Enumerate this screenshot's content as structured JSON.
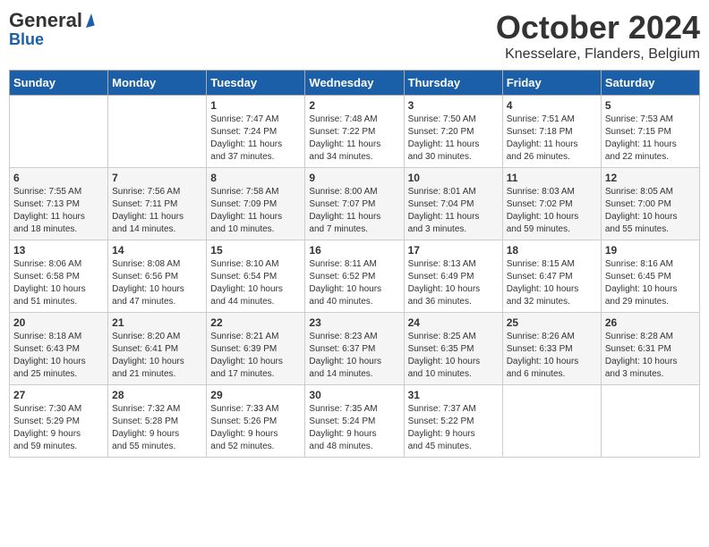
{
  "header": {
    "logo_general": "General",
    "logo_blue": "Blue",
    "month_title": "October 2024",
    "location": "Knesselare, Flanders, Belgium"
  },
  "days_of_week": [
    "Sunday",
    "Monday",
    "Tuesday",
    "Wednesday",
    "Thursday",
    "Friday",
    "Saturday"
  ],
  "weeks": [
    [
      {
        "day": "",
        "content": ""
      },
      {
        "day": "",
        "content": ""
      },
      {
        "day": "1",
        "content": "Sunrise: 7:47 AM\nSunset: 7:24 PM\nDaylight: 11 hours\nand 37 minutes."
      },
      {
        "day": "2",
        "content": "Sunrise: 7:48 AM\nSunset: 7:22 PM\nDaylight: 11 hours\nand 34 minutes."
      },
      {
        "day": "3",
        "content": "Sunrise: 7:50 AM\nSunset: 7:20 PM\nDaylight: 11 hours\nand 30 minutes."
      },
      {
        "day": "4",
        "content": "Sunrise: 7:51 AM\nSunset: 7:18 PM\nDaylight: 11 hours\nand 26 minutes."
      },
      {
        "day": "5",
        "content": "Sunrise: 7:53 AM\nSunset: 7:15 PM\nDaylight: 11 hours\nand 22 minutes."
      }
    ],
    [
      {
        "day": "6",
        "content": "Sunrise: 7:55 AM\nSunset: 7:13 PM\nDaylight: 11 hours\nand 18 minutes."
      },
      {
        "day": "7",
        "content": "Sunrise: 7:56 AM\nSunset: 7:11 PM\nDaylight: 11 hours\nand 14 minutes."
      },
      {
        "day": "8",
        "content": "Sunrise: 7:58 AM\nSunset: 7:09 PM\nDaylight: 11 hours\nand 10 minutes."
      },
      {
        "day": "9",
        "content": "Sunrise: 8:00 AM\nSunset: 7:07 PM\nDaylight: 11 hours\nand 7 minutes."
      },
      {
        "day": "10",
        "content": "Sunrise: 8:01 AM\nSunset: 7:04 PM\nDaylight: 11 hours\nand 3 minutes."
      },
      {
        "day": "11",
        "content": "Sunrise: 8:03 AM\nSunset: 7:02 PM\nDaylight: 10 hours\nand 59 minutes."
      },
      {
        "day": "12",
        "content": "Sunrise: 8:05 AM\nSunset: 7:00 PM\nDaylight: 10 hours\nand 55 minutes."
      }
    ],
    [
      {
        "day": "13",
        "content": "Sunrise: 8:06 AM\nSunset: 6:58 PM\nDaylight: 10 hours\nand 51 minutes."
      },
      {
        "day": "14",
        "content": "Sunrise: 8:08 AM\nSunset: 6:56 PM\nDaylight: 10 hours\nand 47 minutes."
      },
      {
        "day": "15",
        "content": "Sunrise: 8:10 AM\nSunset: 6:54 PM\nDaylight: 10 hours\nand 44 minutes."
      },
      {
        "day": "16",
        "content": "Sunrise: 8:11 AM\nSunset: 6:52 PM\nDaylight: 10 hours\nand 40 minutes."
      },
      {
        "day": "17",
        "content": "Sunrise: 8:13 AM\nSunset: 6:49 PM\nDaylight: 10 hours\nand 36 minutes."
      },
      {
        "day": "18",
        "content": "Sunrise: 8:15 AM\nSunset: 6:47 PM\nDaylight: 10 hours\nand 32 minutes."
      },
      {
        "day": "19",
        "content": "Sunrise: 8:16 AM\nSunset: 6:45 PM\nDaylight: 10 hours\nand 29 minutes."
      }
    ],
    [
      {
        "day": "20",
        "content": "Sunrise: 8:18 AM\nSunset: 6:43 PM\nDaylight: 10 hours\nand 25 minutes."
      },
      {
        "day": "21",
        "content": "Sunrise: 8:20 AM\nSunset: 6:41 PM\nDaylight: 10 hours\nand 21 minutes."
      },
      {
        "day": "22",
        "content": "Sunrise: 8:21 AM\nSunset: 6:39 PM\nDaylight: 10 hours\nand 17 minutes."
      },
      {
        "day": "23",
        "content": "Sunrise: 8:23 AM\nSunset: 6:37 PM\nDaylight: 10 hours\nand 14 minutes."
      },
      {
        "day": "24",
        "content": "Sunrise: 8:25 AM\nSunset: 6:35 PM\nDaylight: 10 hours\nand 10 minutes."
      },
      {
        "day": "25",
        "content": "Sunrise: 8:26 AM\nSunset: 6:33 PM\nDaylight: 10 hours\nand 6 minutes."
      },
      {
        "day": "26",
        "content": "Sunrise: 8:28 AM\nSunset: 6:31 PM\nDaylight: 10 hours\nand 3 minutes."
      }
    ],
    [
      {
        "day": "27",
        "content": "Sunrise: 7:30 AM\nSunset: 5:29 PM\nDaylight: 9 hours\nand 59 minutes."
      },
      {
        "day": "28",
        "content": "Sunrise: 7:32 AM\nSunset: 5:28 PM\nDaylight: 9 hours\nand 55 minutes."
      },
      {
        "day": "29",
        "content": "Sunrise: 7:33 AM\nSunset: 5:26 PM\nDaylight: 9 hours\nand 52 minutes."
      },
      {
        "day": "30",
        "content": "Sunrise: 7:35 AM\nSunset: 5:24 PM\nDaylight: 9 hours\nand 48 minutes."
      },
      {
        "day": "31",
        "content": "Sunrise: 7:37 AM\nSunset: 5:22 PM\nDaylight: 9 hours\nand 45 minutes."
      },
      {
        "day": "",
        "content": ""
      },
      {
        "day": "",
        "content": ""
      }
    ]
  ]
}
